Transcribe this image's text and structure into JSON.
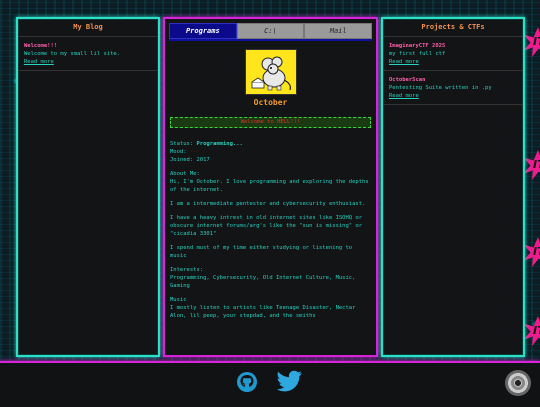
{
  "left_panel": {
    "title": "My Blog",
    "posts": [
      {
        "title": "Welcome!!!",
        "text": "Welcome to my small lil site.",
        "more": "Read more"
      }
    ]
  },
  "center": {
    "tabs": [
      {
        "label": "Programs",
        "active": true
      },
      {
        "label": "C:\\",
        "active": false
      },
      {
        "label": "Mail",
        "active": false
      }
    ],
    "profile_name": "October",
    "welcome_text": "Welcome to HELL!!!",
    "status_label": "Status:",
    "status_value": "Programming...",
    "mood_label": "Mood:",
    "mood_value": "---",
    "joined_label": "Joined:",
    "joined_value": "2017",
    "about_heading": "About Me:",
    "about_lines": [
      "Hi, I'm October. I love programming and exploring the depths of the internet.",
      "I am a intermediate pentester and cybersecurity enthusiast.",
      "I have a heavy intrest in old internet sites like ISOHQ or obscure internet forums/arg's like the \"sun is missing\" or \"cicadia 3301\"",
      "I spend must of my time either studying or listening to music"
    ],
    "interests_heading": "Interests:",
    "interests_text": "Programming, Cybersecurity, Old Internet Culture, Music, Gaming",
    "music_heading": "Music",
    "music_text": "I mostly listen to artists like Teenage Disaster, Nectar Alon, lil peep, your stepdad, and the smiths"
  },
  "right_panel": {
    "title": "Projects & CTFs",
    "posts": [
      {
        "title": "ImaginaryCTF 2025",
        "text": "my first full ctf",
        "more": "Read more"
      },
      {
        "title": "OctoberScan",
        "text": "Pentesting Suite written in .py",
        "more": "Read more"
      }
    ]
  },
  "decor": {
    "burst_text": "IT"
  },
  "footer": {
    "icons": [
      "github-icon",
      "twitter-icon",
      "cd-icon"
    ]
  },
  "colors": {
    "cyan": "#2de0c8",
    "magenta": "#d425d8",
    "orange": "#f59a2a",
    "pink": "#ff5fae"
  }
}
